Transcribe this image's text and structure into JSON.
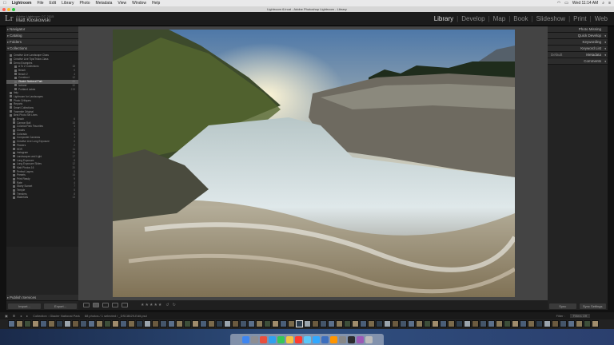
{
  "menubar": {
    "app": "Lightroom",
    "items": [
      "File",
      "Edit",
      "Library",
      "Photo",
      "Metadata",
      "View",
      "Window",
      "Help"
    ],
    "right": "Wed 11:14 AM"
  },
  "window": {
    "title": "Lightroom 6.lrcat - Adobe Photoshop Lightroom - Library"
  },
  "identity": {
    "logo": "Lr",
    "line1": "Adobe Lightroom CC 2015",
    "user": "Matt Kloskowski"
  },
  "modules": [
    "Library",
    "Develop",
    "Map",
    "Book",
    "Slideshow",
    "Print",
    "Web"
  ],
  "active_module": "Library",
  "left_panel": {
    "navigator": "Navigator",
    "catalog": "Catalog",
    "folders": "Folders",
    "collections": "Collections",
    "publish": "Publish Services",
    "import_btn": "Import...",
    "export_btn": "Export...",
    "collection_rows": [
      {
        "label": "Creative Live Landscape Class",
        "count": ""
      },
      {
        "label": "Creative Live Tips/Tricks Class",
        "count": ""
      },
      {
        "label": "Demo Examples",
        "count": ""
      },
      {
        "label": "A To Z Collections",
        "count": "18"
      },
      {
        "label": "Beach",
        "count": "6"
      },
      {
        "label": "Beach 2",
        "count": "4"
      },
      {
        "label": "Construct",
        "count": "12"
      },
      {
        "label": "Glacier National Park",
        "count": "88"
      },
      {
        "label": "Iceland",
        "count": "32"
      },
      {
        "label": "Portland Lakes",
        "count": "215"
      },
      {
        "label": "Italy",
        "count": ""
      },
      {
        "label": "Lightroom for Landscapes",
        "count": ""
      },
      {
        "label": "Photo Critiques",
        "count": ""
      },
      {
        "label": "Reports",
        "count": ""
      },
      {
        "label": "Smart Collections",
        "count": ""
      },
      {
        "label": "Yosemite Original",
        "count": ""
      },
      {
        "label": "Best Photo Set Lines",
        "count": ""
      },
      {
        "label": "Beach",
        "count": "6"
      },
      {
        "label": "Cannon Ball",
        "count": "15"
      },
      {
        "label": "Colonial Park Favorites",
        "count": "4"
      },
      {
        "label": "Clouds",
        "count": "7"
      },
      {
        "label": "Colorado",
        "count": "9"
      },
      {
        "label": "Composite Cameras",
        "count": "3"
      },
      {
        "label": "Creative Live Long Exposure",
        "count": "6"
      },
      {
        "label": "Flowers",
        "count": "2"
      },
      {
        "label": "HDR",
        "count": "11"
      },
      {
        "label": "Instagram",
        "count": "14"
      },
      {
        "label": "Landscapes and Light",
        "count": "17"
      },
      {
        "label": "Long Exposure",
        "count": "8"
      },
      {
        "label": "Long Exposure Slides",
        "count": "12"
      },
      {
        "label": "Matt Photos 16",
        "count": "20"
      },
      {
        "label": "Perfect Layers",
        "count": "5"
      },
      {
        "label": "Presets",
        "count": "14"
      },
      {
        "label": "Print Ready",
        "count": "9"
      },
      {
        "label": "Rate",
        "count": "4"
      },
      {
        "label": "Starry Sunset",
        "count": "7"
      },
      {
        "label": "Temple",
        "count": "5"
      },
      {
        "label": "Trenders",
        "count": "8"
      },
      {
        "label": "Waterfalls",
        "count": "13"
      }
    ],
    "selected_index": 7
  },
  "right_panel": {
    "photo_missing": "Photo Missing",
    "quick_develop": "Quick Develop",
    "keywording": "Keywording",
    "keyword_list": "Keyword List",
    "metadata": "Metadata",
    "metadata_preset": "Default",
    "comments": "Comments",
    "sync_btn": "Sync",
    "sync_settings_btn": "Sync Settings"
  },
  "toolbar": {
    "stars": "★★★★★"
  },
  "filmstrip_bar": {
    "path": "Collection : Glacier National Park",
    "info": "88 photos / 1 selected / _DSC8629-Edit.psd",
    "filter_label": "Filter :",
    "filter_value": "Filters Off"
  },
  "colors": {
    "accent": "#dddddd",
    "panel": "#232323",
    "selected_row": "#585858"
  }
}
